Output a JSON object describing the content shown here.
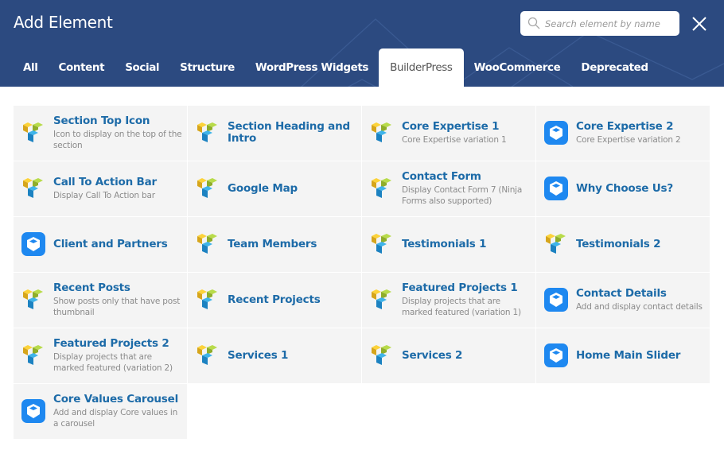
{
  "header": {
    "title": "Add Element",
    "search": {
      "placeholder": "Search element by name",
      "value": "",
      "icon": "search-icon"
    },
    "close_icon": "close-icon"
  },
  "tabs": [
    {
      "label": "All",
      "active": false
    },
    {
      "label": "Content",
      "active": false
    },
    {
      "label": "Social",
      "active": false
    },
    {
      "label": "Structure",
      "active": false
    },
    {
      "label": "WordPress Widgets",
      "active": false
    },
    {
      "label": "BuilderPress",
      "active": true
    },
    {
      "label": "WooCommerce",
      "active": false
    },
    {
      "label": "Deprecated",
      "active": false
    }
  ],
  "colors": {
    "header_bg": "#2c4a80",
    "title_text": "#1d6ba8",
    "desc_text": "#8b8b8b",
    "cell_bg": "#f4f4f4",
    "blue_icon": "#1e88f0"
  },
  "elements": [
    {
      "title": "Section Top Icon",
      "description": "Icon to display on the top of the section",
      "icon": "vc-cubes-icon"
    },
    {
      "title": "Section Heading and Intro",
      "description": "",
      "icon": "vc-cubes-icon"
    },
    {
      "title": "Core Expertise 1",
      "description": "Core Expertise variation 1",
      "icon": "vc-cubes-icon"
    },
    {
      "title": "Core Expertise 2",
      "description": "Core Expertise variation 2",
      "icon": "box-app-icon"
    },
    {
      "title": "Call To Action Bar",
      "description": "Display Call To Action bar",
      "icon": "vc-cubes-icon"
    },
    {
      "title": "Google Map",
      "description": "",
      "icon": "vc-cubes-icon"
    },
    {
      "title": "Contact Form",
      "description": "Display Contact Form 7 (Ninja Forms also supported)",
      "icon": "vc-cubes-icon"
    },
    {
      "title": "Why Choose Us?",
      "description": "",
      "icon": "box-app-icon"
    },
    {
      "title": "Client and Partners",
      "description": "",
      "icon": "box-app-icon"
    },
    {
      "title": "Team Members",
      "description": "",
      "icon": "vc-cubes-icon"
    },
    {
      "title": "Testimonials 1",
      "description": "",
      "icon": "vc-cubes-icon"
    },
    {
      "title": "Testimonials 2",
      "description": "",
      "icon": "vc-cubes-icon"
    },
    {
      "title": "Recent Posts",
      "description": "Show posts only that have post thumbnail",
      "icon": "vc-cubes-icon"
    },
    {
      "title": "Recent Projects",
      "description": "",
      "icon": "vc-cubes-icon"
    },
    {
      "title": "Featured Projects 1",
      "description": "Display projects that are marked featured (variation 1)",
      "icon": "vc-cubes-icon"
    },
    {
      "title": "Contact Details",
      "description": "Add and display contact details",
      "icon": "box-app-icon"
    },
    {
      "title": "Featured Projects 2",
      "description": "Display projects that are marked featured (variation 2)",
      "icon": "vc-cubes-icon"
    },
    {
      "title": "Services 1",
      "description": "",
      "icon": "vc-cubes-icon"
    },
    {
      "title": "Services 2",
      "description": "",
      "icon": "vc-cubes-icon"
    },
    {
      "title": "Home Main Slider",
      "description": "",
      "icon": "box-app-icon"
    },
    {
      "title": "Core Values Carousel",
      "description": "Add and display Core values in a carousel",
      "icon": "box-app-icon"
    }
  ]
}
